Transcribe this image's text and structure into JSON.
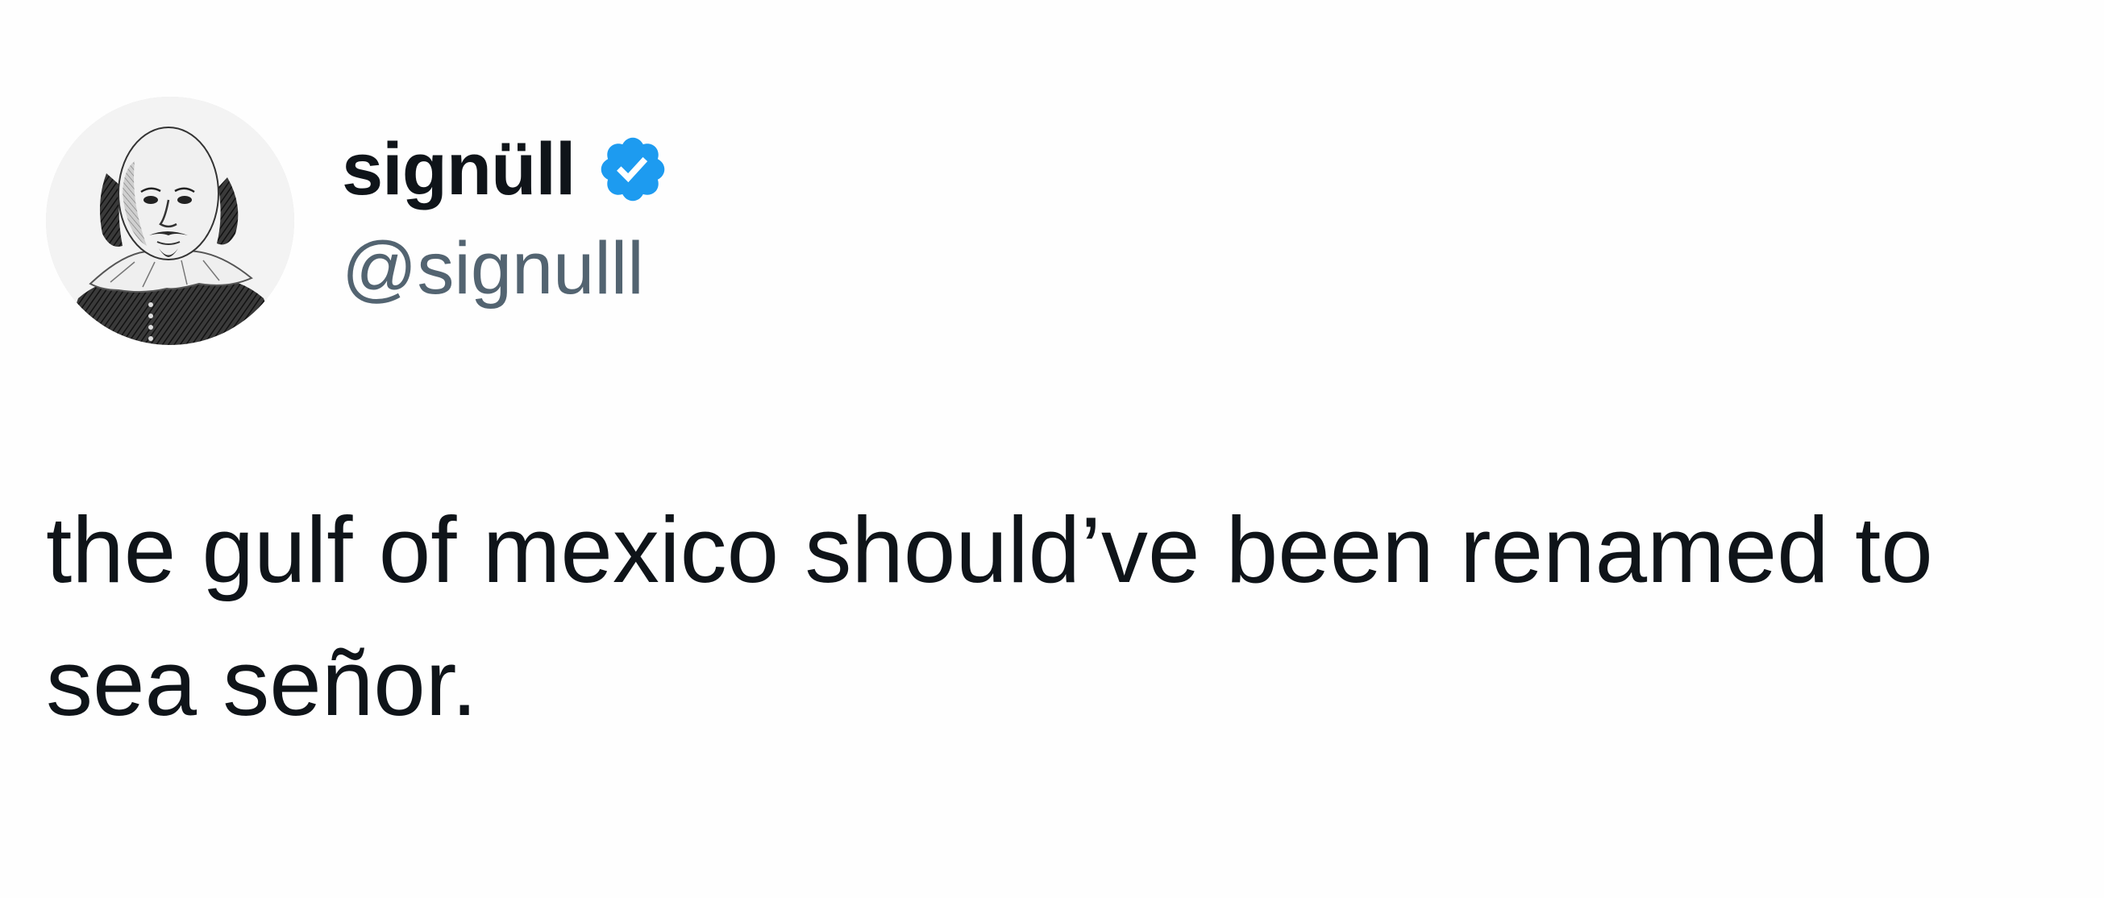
{
  "tweet": {
    "author": {
      "display_name": "signüll",
      "handle": "@signulll",
      "verified": true,
      "verified_icon": "verified-badge-icon",
      "avatar": "avatar-portrait-engraving"
    },
    "text": "the gulf of mexico should’ve been renamed to sea señor."
  },
  "colors": {
    "background": "#fefefe",
    "text_primary": "#0f1419",
    "text_secondary": "#536471",
    "verified_blue": "#1d9bf0"
  }
}
